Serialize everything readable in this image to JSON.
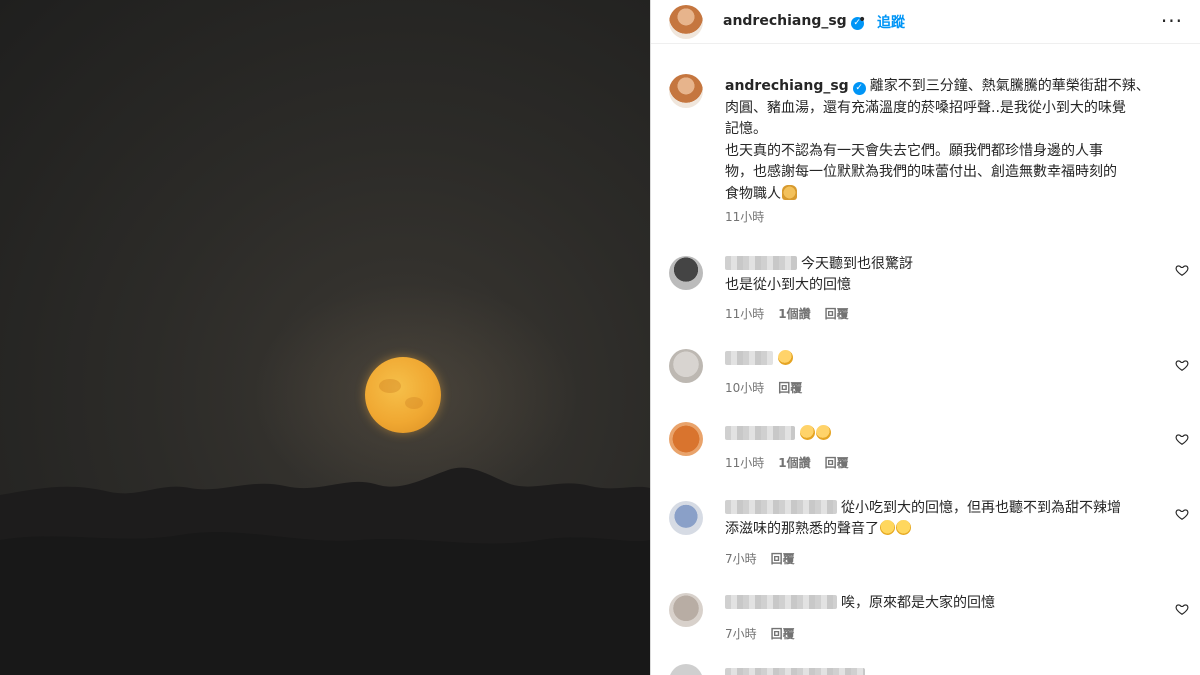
{
  "post": {
    "username": "andrechiang_sg",
    "verified_mark": "✓",
    "follow_label": "追蹤",
    "separator": "•",
    "more_label": "···",
    "caption_lines": [
      "離家不到三分鐘、熱氣騰騰的華榮街甜不辣、",
      "肉圓、豬血湯，還有充滿溫度的菸嗓招呼聲..是我從小到大的味覺",
      "記憶。",
      "也天真的不認為有一天會失去它們。願我們都珍惜身邊的人事",
      "物，也感謝每一位默默為我們的味蕾付出、創造無數幸福時刻的",
      "食物職人"
    ],
    "caption_emoji": "pray-emoji",
    "time": "11小時"
  },
  "comments": [
    {
      "text_line1": "今天聽到也很驚訝",
      "text_line2": "也是從小到大的回憶",
      "time": "11小時",
      "likes": "1個讚",
      "reply": "回覆"
    },
    {
      "text_line1": "",
      "emojis": [
        "clap-emoji"
      ],
      "time": "10小時",
      "reply": "回覆"
    },
    {
      "text_line1": "",
      "emojis": [
        "clap-emoji",
        "clap-emoji"
      ],
      "time": "11小時",
      "likes": "1個讚",
      "reply": "回覆"
    },
    {
      "text_line1": "從小吃到大的回憶，但再也聽不到為甜不辣增",
      "text_line2": "添滋味的那熟悉的聲音了",
      "emojis": [
        "sad-emoji",
        "sad-emoji"
      ],
      "time": "7小時",
      "reply": "回覆"
    },
    {
      "text_line1": "唉，原來都是大家的回憶",
      "time": "7小時",
      "reply": "回覆"
    }
  ],
  "colors": {
    "accent": "#0095f6",
    "moon": "#f0a832",
    "muted": "#737373"
  },
  "icons": [
    "verified-icon",
    "more-icon",
    "heart-icon"
  ]
}
